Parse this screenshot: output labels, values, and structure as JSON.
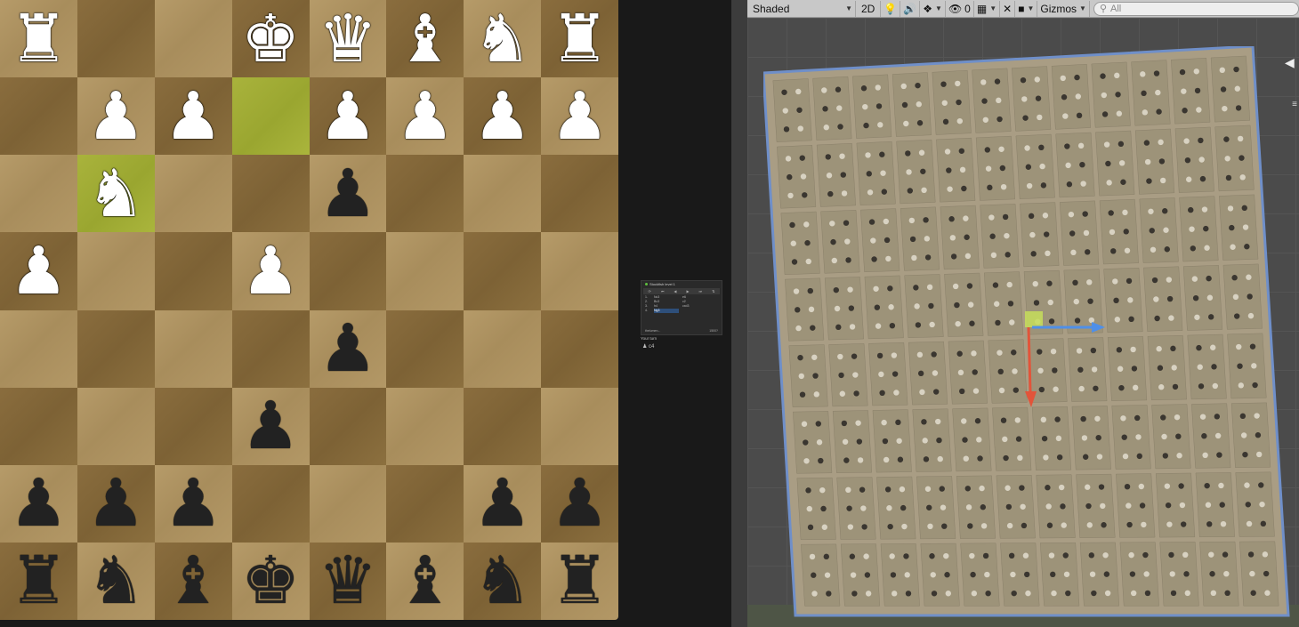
{
  "board": {
    "highlight_squares": [
      "d7",
      "b6"
    ],
    "pieces": {
      "a8": "wR",
      "d8": "wK",
      "e8": "wQ",
      "f8": "wB",
      "g8": "wN",
      "h8": "wR",
      "b7": "wP",
      "c7": "wP",
      "e7": "wP",
      "f7": "wP",
      "g7": "wP",
      "h7": "wP",
      "b6": "wN",
      "e6": "bP",
      "a5": "wP",
      "d5": "wP",
      "e4": "bP",
      "d3": "bP",
      "a2": "bP",
      "b2": "bP",
      "c2": "bP",
      "g2": "bP",
      "h2": "bP",
      "a1": "bR",
      "b1": "bN",
      "c1": "bB",
      "d1": "bK",
      "e1": "bQ",
      "f1": "bB",
      "g1": "bN",
      "h1": "bR"
    },
    "colors": {
      "light": "#b09562",
      "dark": "#846838",
      "highlight": "#a2ac36"
    }
  },
  "mini_panel": {
    "title": "Stockfish level 1",
    "moves": [
      {
        "n": "1.",
        "w": "Nc3",
        "b": "e6"
      },
      {
        "n": "2.",
        "w": "Bc3",
        "b": "c2"
      },
      {
        "n": "3.",
        "w": "h4",
        "b": "cxd3"
      },
      {
        "n": "4.",
        "w": "Ng3",
        "b": ""
      }
    ],
    "player": "thelumen...",
    "score": "1500?",
    "turn_label": "Your turn",
    "turn_value": "c4"
  },
  "scene_toolbar": {
    "shading_mode": "Shaded",
    "mode_2d": "2D",
    "hidden_count": "0",
    "gizmos_label": "Gizmos",
    "search_placeholder": "All"
  },
  "scene": {
    "icons": [
      "light-bulb-icon",
      "audio-icon",
      "effects-icon",
      "visibility-icon",
      "grid-icon",
      "tools-icon",
      "camera-icon"
    ]
  }
}
